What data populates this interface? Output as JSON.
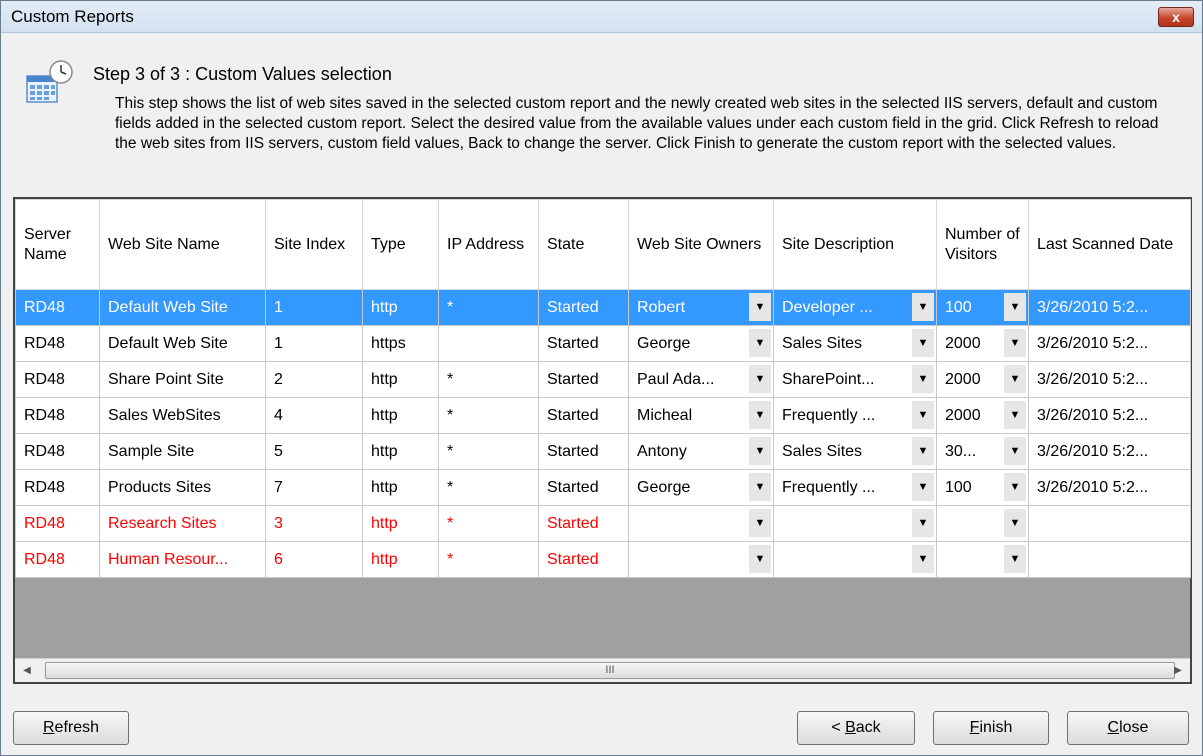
{
  "window": {
    "title": "Custom Reports",
    "close_glyph": "x"
  },
  "header": {
    "step_title": "Step 3 of 3 : Custom Values selection",
    "description": "This step shows the list of web sites saved in the selected custom report and the newly created web sites in the selected IIS servers, default and custom fields added in the selected custom report. Select the desired value from the available values under each custom field in the grid. Click Refresh to reload the web sites from IIS servers, custom field values, Back to change the server. Click Finish to generate the custom report with the selected values."
  },
  "grid": {
    "columns": [
      "Server Name",
      "Web Site Name",
      "Site Index",
      "Type",
      "IP Address",
      "State",
      "Web Site Owners",
      "Site Description",
      "Number of Visitors",
      "Last Scanned Date"
    ],
    "rows": [
      {
        "server": "RD48",
        "site": "Default Web Site",
        "index": "1",
        "type": "http",
        "ip": "*",
        "state": "Started",
        "owners": "Robert",
        "description": "Developer ...",
        "visitors": "100",
        "scanned": "3/26/2010 5:2...",
        "status": "selected"
      },
      {
        "server": "RD48",
        "site": "Default Web Site",
        "index": "1",
        "type": "https",
        "ip": "",
        "state": "Started",
        "owners": "George",
        "description": "Sales Sites",
        "visitors": "2000",
        "scanned": "3/26/2010 5:2...",
        "status": "normal"
      },
      {
        "server": "RD48",
        "site": "Share Point Site",
        "index": "2",
        "type": "http",
        "ip": "*",
        "state": "Started",
        "owners": "Paul Ada...",
        "description": "SharePoint...",
        "visitors": "2000",
        "scanned": "3/26/2010 5:2...",
        "status": "normal"
      },
      {
        "server": "RD48",
        "site": "Sales WebSites",
        "index": "4",
        "type": "http",
        "ip": "*",
        "state": "Started",
        "owners": "Micheal",
        "description": "Frequently ...",
        "visitors": "2000",
        "scanned": "3/26/2010 5:2...",
        "status": "normal"
      },
      {
        "server": "RD48",
        "site": "Sample Site",
        "index": "5",
        "type": "http",
        "ip": "*",
        "state": "Started",
        "owners": "Antony",
        "description": "Sales Sites",
        "visitors": "30...",
        "scanned": "3/26/2010 5:2...",
        "status": "normal"
      },
      {
        "server": "RD48",
        "site": "Products Sites",
        "index": "7",
        "type": "http",
        "ip": "*",
        "state": "Started",
        "owners": "George",
        "description": "Frequently ...",
        "visitors": "100",
        "scanned": "3/26/2010 5:2...",
        "status": "normal"
      },
      {
        "server": "RD48",
        "site": "Research Sites",
        "index": "3",
        "type": "http",
        "ip": "*",
        "state": "Started",
        "owners": "",
        "description": "",
        "visitors": "",
        "scanned": "",
        "status": "new"
      },
      {
        "server": "RD48",
        "site": "Human Resour...",
        "index": "6",
        "type": "http",
        "ip": "*",
        "state": "Started",
        "owners": "",
        "description": "",
        "visitors": "",
        "scanned": "",
        "status": "new"
      }
    ],
    "scroll_grip": "III"
  },
  "buttons": {
    "refresh": {
      "pre": "",
      "key": "R",
      "post": "efresh"
    },
    "back": {
      "pre": "< ",
      "key": "B",
      "post": "ack"
    },
    "finish": {
      "pre": "",
      "key": "F",
      "post": "inish"
    },
    "close": {
      "pre": "",
      "key": "C",
      "post": "lose"
    }
  },
  "colors": {
    "selected_row": "#3399ff",
    "new_site_text": "#ff0000",
    "window_bg": "#f0f0f0"
  },
  "icons": {
    "wizard": "report-calendar-clock-icon",
    "dropdown": "chevron-down-icon",
    "scroll_left": "arrow-left-icon",
    "scroll_right": "arrow-right-icon"
  }
}
